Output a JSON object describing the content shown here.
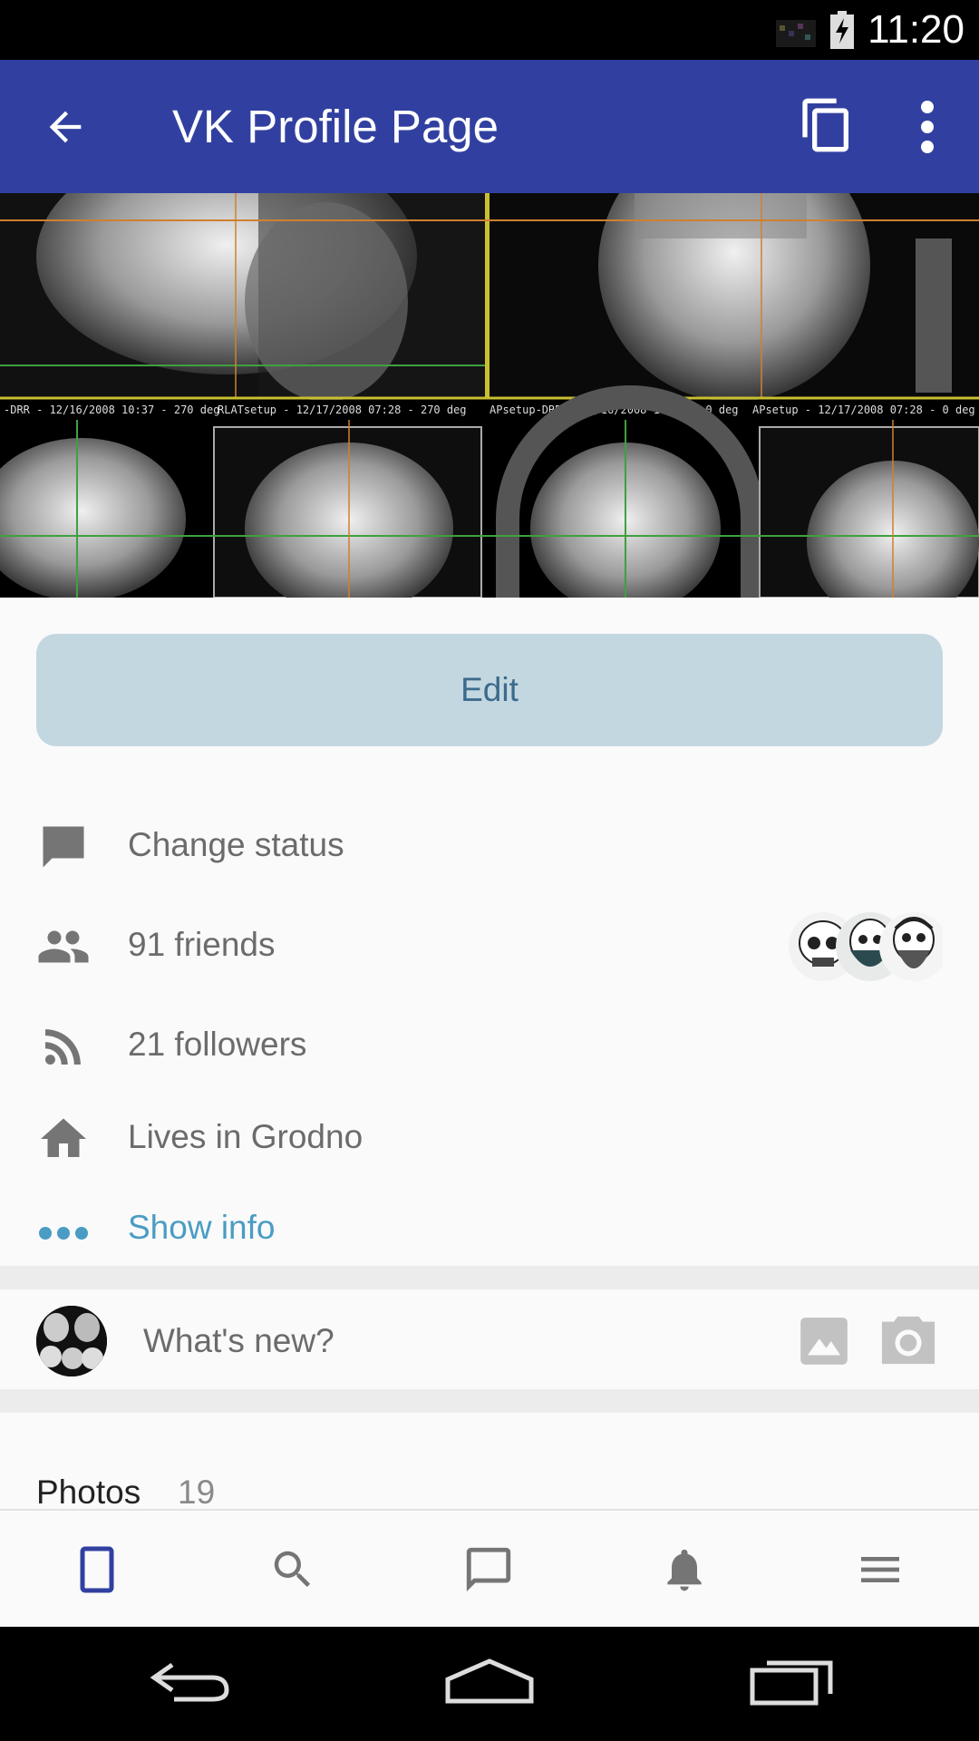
{
  "status_bar": {
    "time": "11:20"
  },
  "app_bar": {
    "title": "VK Profile Page"
  },
  "edit_button": {
    "label": "Edit"
  },
  "profile_items": [
    {
      "label": "Change status",
      "icon": "chat-bubble-icon"
    },
    {
      "label": "91 friends",
      "icon": "people-icon"
    },
    {
      "label": "21 followers",
      "icon": "rss-icon"
    },
    {
      "label": "Lives in Grodno",
      "icon": "home-icon"
    },
    {
      "label": "Show info",
      "icon": "more-dots-icon"
    }
  ],
  "post_box": {
    "placeholder": "What's new?"
  },
  "photos": {
    "title": "Photos",
    "count": "19"
  },
  "colors": {
    "app_bar": "#3140a0",
    "edit_button_bg": "#c3d7e1",
    "edit_button_text": "#3c6a8c",
    "link": "#4a9cc3",
    "nav_active": "#3140a0"
  }
}
